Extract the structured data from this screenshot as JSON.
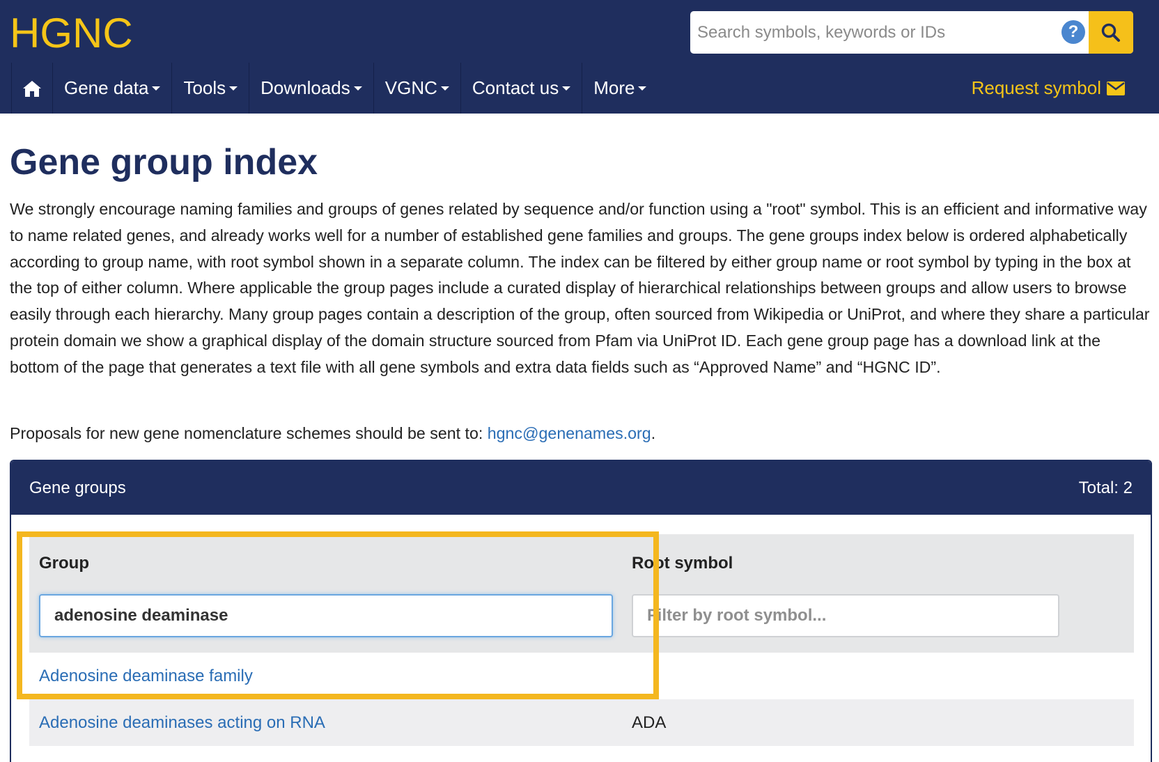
{
  "header": {
    "logo": "HGNC",
    "search": {
      "placeholder": "Search symbols, keywords or IDs",
      "help_icon": "?"
    },
    "nav": [
      {
        "label": "Gene data"
      },
      {
        "label": "Tools"
      },
      {
        "label": "Downloads"
      },
      {
        "label": "VGNC"
      },
      {
        "label": "Contact us"
      },
      {
        "label": "More"
      }
    ],
    "request_symbol": "Request symbol"
  },
  "page": {
    "title": "Gene group index",
    "intro": "We strongly encourage naming families and groups of genes related by sequence and/or function using a \"root\" symbol. This is an efficient and informative way to name related genes, and already works well for a number of established gene families and groups. The gene groups index below is ordered alphabetically according to group name, with root symbol shown in a separate column. The index can be filtered by either group name or root symbol by typing in the box at the top of either column. Where applicable the group pages include a curated display of hierarchical relationships between groups and allow users to browse easily through each hierarchy. Many group pages contain a description of the group, often sourced from Wikipedia or UniProt, and where they share a particular protein domain we show a graphical display of the domain structure sourced from Pfam via UniProt ID. Each gene group page has a download link at the bottom of the page that generates a text file with all gene symbols and extra data fields such as “Approved Name” and “HGNC ID”.",
    "proposals_text": "Proposals for new gene nomenclature schemes should be sent to: ",
    "proposals_email": "hgnc@genenames.org",
    "proposals_end": "."
  },
  "panel": {
    "title": "Gene groups",
    "total": "Total: 2",
    "columns": {
      "group": "Group",
      "root": "Root symbol"
    },
    "filters": {
      "group_value": "adenosine deaminase",
      "root_placeholder": "Filter by root symbol..."
    },
    "rows": [
      {
        "group": "Adenosine deaminase family",
        "root": ""
      },
      {
        "group": "Adenosine deaminases acting on RNA",
        "root": "ADA"
      }
    ]
  },
  "colors": {
    "navy": "#1f2e5e",
    "gold": "#f5c518",
    "highlight": "#f4b71f",
    "link": "#2a6db5"
  },
  "icons": [
    "home-icon",
    "search-icon",
    "help-icon",
    "envelope-icon",
    "caret-down-icon"
  ]
}
